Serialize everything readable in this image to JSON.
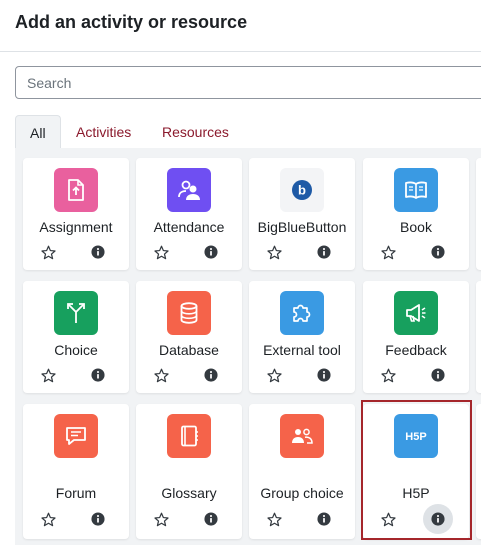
{
  "modal": {
    "title": "Add an activity or resource",
    "search_placeholder": "Search"
  },
  "tabs": [
    {
      "label": "All",
      "active": true
    },
    {
      "label": "Activities",
      "active": false
    },
    {
      "label": "Resources",
      "active": false
    }
  ],
  "items": [
    {
      "label": "Assignment",
      "icon": "assignment-icon",
      "color": "#e9609e"
    },
    {
      "label": "Attendance",
      "icon": "attendance-icon",
      "color": "#6f4ff2"
    },
    {
      "label": "BigBlueButton",
      "icon": "bigbluebutton-icon",
      "color": "#f3f4f6"
    },
    {
      "label": "Book",
      "icon": "book-icon",
      "color": "#3a9ae3"
    },
    {
      "label": "Choice",
      "icon": "choice-icon",
      "color": "#17a05e"
    },
    {
      "label": "Database",
      "icon": "database-icon",
      "color": "#f5634a"
    },
    {
      "label": "External tool",
      "icon": "external-tool-icon",
      "color": "#3a9ae3"
    },
    {
      "label": "Feedback",
      "icon": "feedback-icon",
      "color": "#17a05e"
    },
    {
      "label": "Forum",
      "icon": "forum-icon",
      "color": "#f5634a"
    },
    {
      "label": "Glossary",
      "icon": "glossary-icon",
      "color": "#f5634a"
    },
    {
      "label": "Group choice",
      "icon": "group-choice-icon",
      "color": "#f5634a"
    },
    {
      "label": "H5P",
      "icon": "h5p-icon",
      "color": "#3a9ae3"
    }
  ],
  "colors": {
    "accent_link": "#8b1a2d",
    "highlight_border": "#a5262b",
    "grid_background": "#f1f3f5"
  }
}
